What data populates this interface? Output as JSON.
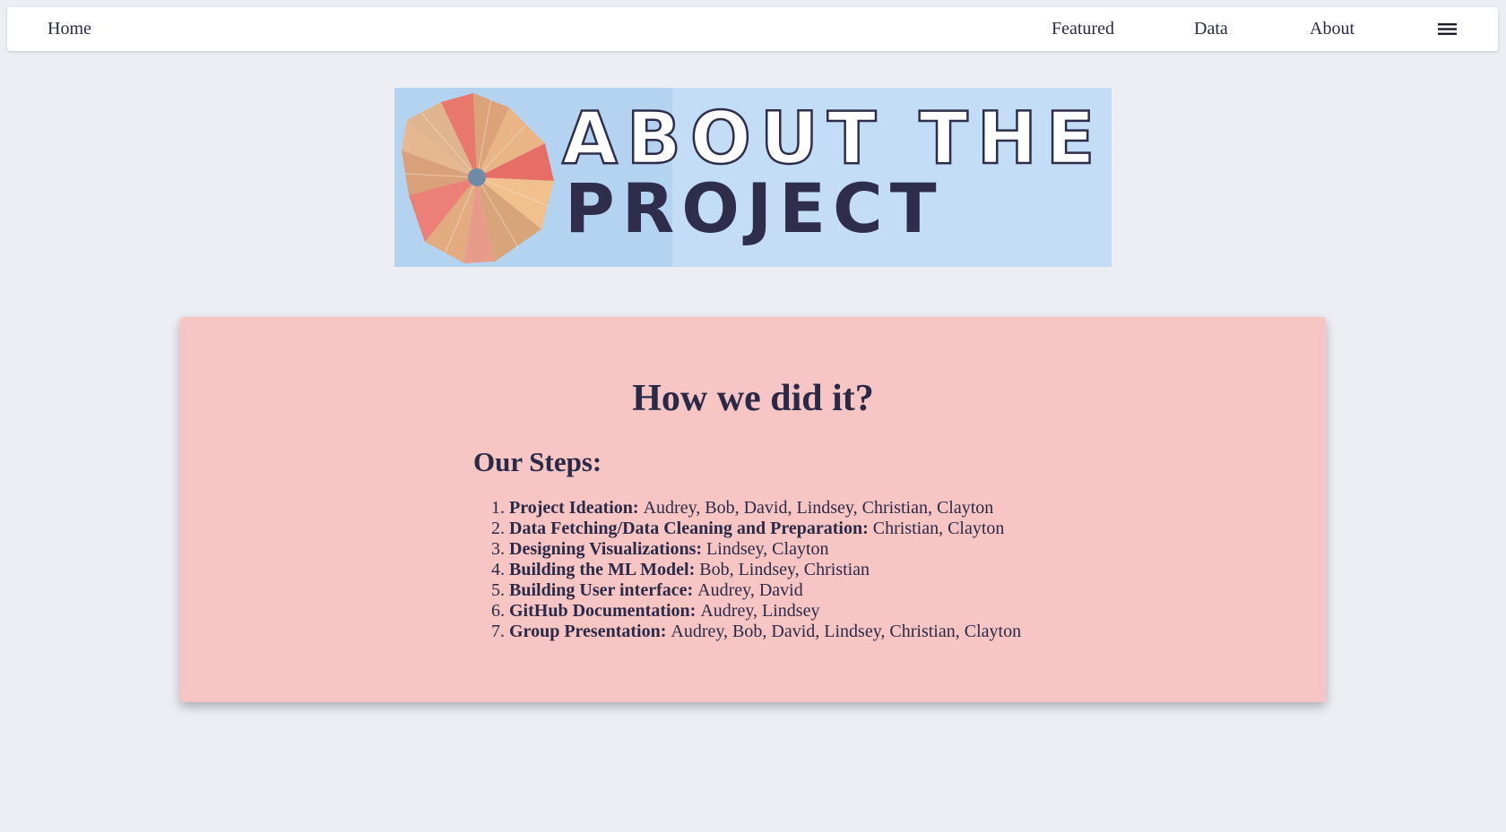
{
  "nav": {
    "home": "Home",
    "links": [
      "Featured",
      "Data",
      "About"
    ],
    "menu_icon": "hamburger-menu-icon"
  },
  "banner": {
    "line1": "ABOUT THE",
    "line2": "PROJECT",
    "bg_color": "#c2ddf5",
    "text_color": "#2e2e4c"
  },
  "card": {
    "title": "How we did it?",
    "steps_heading": "Our Steps:",
    "bg_color": "#f7c6c4",
    "steps": [
      {
        "num": "1.",
        "label": "Project Ideation:",
        "people": "Audrey, Bob, David, Lindsey, Christian, Clayton"
      },
      {
        "num": "2.",
        "label": "Data Fetching/Data Cleaning and Preparation:",
        "people": "Christian, Clayton"
      },
      {
        "num": "3.",
        "label": "Designing Visualizations:",
        "people": "Lindsey, Clayton"
      },
      {
        "num": "4.",
        "label": "Building the ML Model:",
        "people": "Bob, Lindsey, Christian"
      },
      {
        "num": "5.",
        "label": "Building User interface:",
        "people": "Audrey, David"
      },
      {
        "num": "6.",
        "label": "GitHub Documentation:",
        "people": "Audrey, Lindsey"
      },
      {
        "num": "7.",
        "label": "Group Presentation:",
        "people": "Audrey, Bob, David, Lindsey, Christian, Clayton"
      }
    ]
  },
  "colors": {
    "page_bg": "#eceef3",
    "text": "#2a2a48"
  }
}
